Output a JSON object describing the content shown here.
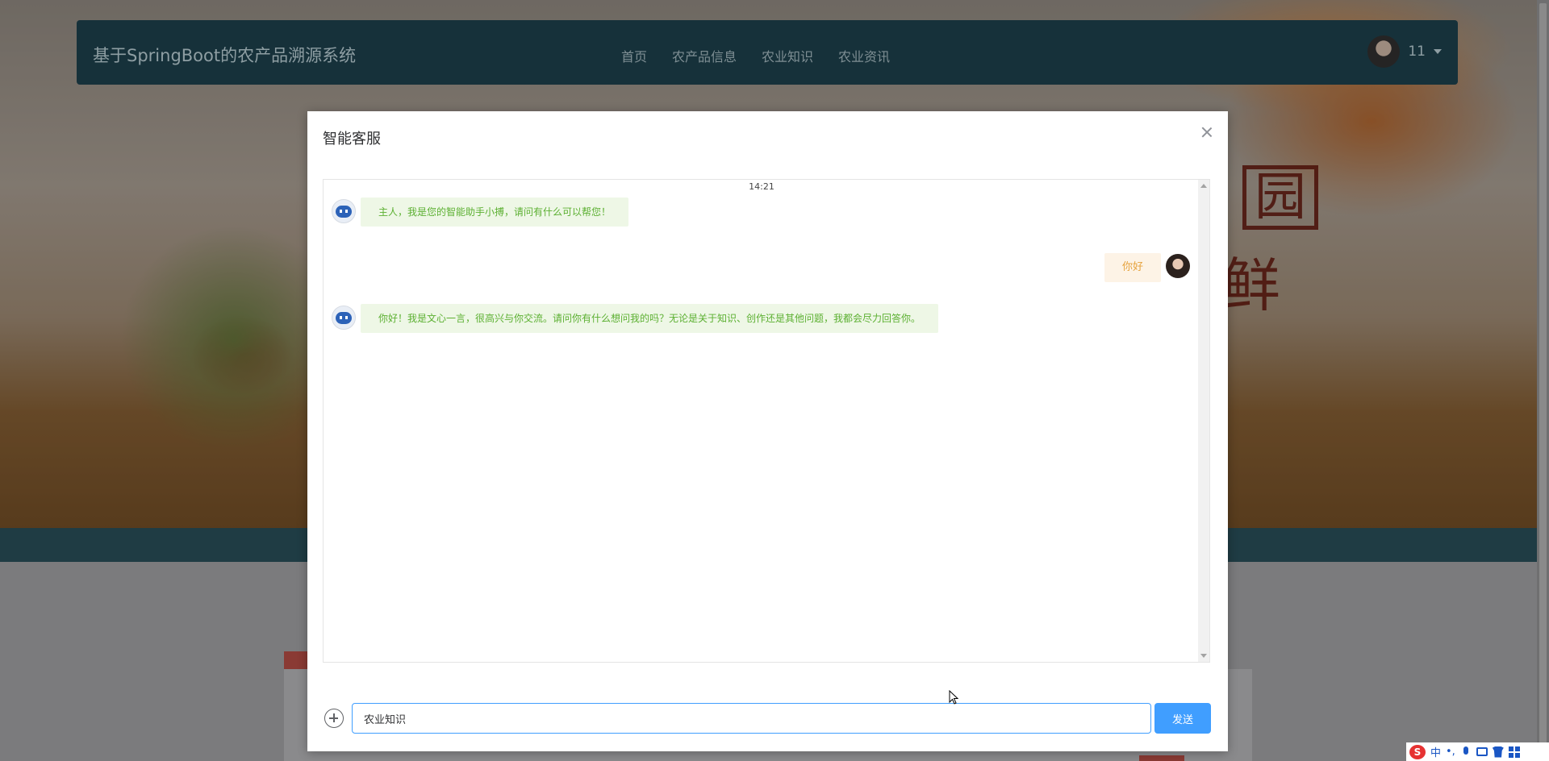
{
  "navbar": {
    "brand": "基于SpringBoot的农产品溯源系统",
    "links": [
      "首页",
      "农产品信息",
      "农业知识",
      "农业资讯"
    ],
    "user_name": "11"
  },
  "background": {
    "hero_chars": [
      "园",
      "鲜"
    ]
  },
  "dialog": {
    "title": "智能客服",
    "time": "14:21",
    "messages": [
      {
        "from": "bot",
        "text": "主人，我是您的智能助手小搏，请问有什么可以帮您！"
      },
      {
        "from": "user",
        "text": "你好"
      },
      {
        "from": "bot",
        "text": "你好！我是文心一言，很高兴与你交流。请问你有什么想问我的吗？无论是关于知识、创作还是其他问题，我都会尽力回答你。"
      }
    ],
    "input_value": "农业知识",
    "send_label": "发送"
  },
  "ime": {
    "logo": "S",
    "mode": "中",
    "punct": "•,"
  },
  "colors": {
    "primary": "#409eff",
    "bot_bubble_bg": "#eef7e6",
    "bot_text": "#5cb032",
    "user_bubble_bg": "#fdf3e6",
    "user_text": "#e6a23c",
    "navbar_bg": "#16313a"
  }
}
